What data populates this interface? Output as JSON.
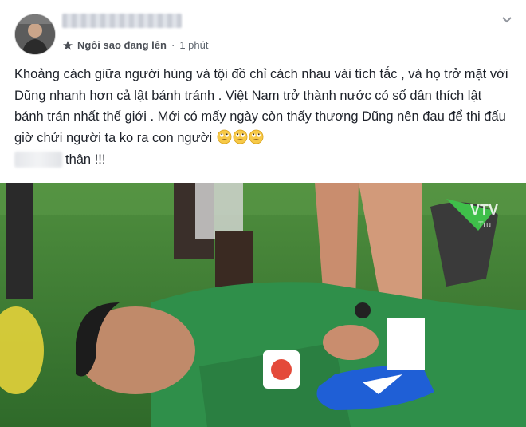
{
  "post": {
    "author_status": "Ngôi sao đang lên",
    "separator": "·",
    "time": "1 phút",
    "body": "Khoảng cách giữa người hùng và tội đồ chỉ cách nhau vài tích tắc , và họ trở mặt với Dũng nhanh hơn cả lật bánh tránh . Việt Nam trở thành nước có số dân thích lật bánh trán nhất thế giới . Mới có mấy ngày còn thấy thương Dũng nên đau để thi đấu giờ chửi người ta ko ra con người",
    "line2": "thân !!!",
    "emojis": [
      "eye-roll-emoji",
      "eye-roll-emoji",
      "eye-roll-emoji"
    ]
  },
  "photo": {
    "broadcaster_logo": "VTV",
    "broadcaster_sub": "Tru"
  },
  "colors": {
    "text": "#1d2129",
    "meta": "#606770",
    "grass": "#3d7a36",
    "jersey": "#2f8f4a",
    "boot": "#1f5fd6"
  }
}
